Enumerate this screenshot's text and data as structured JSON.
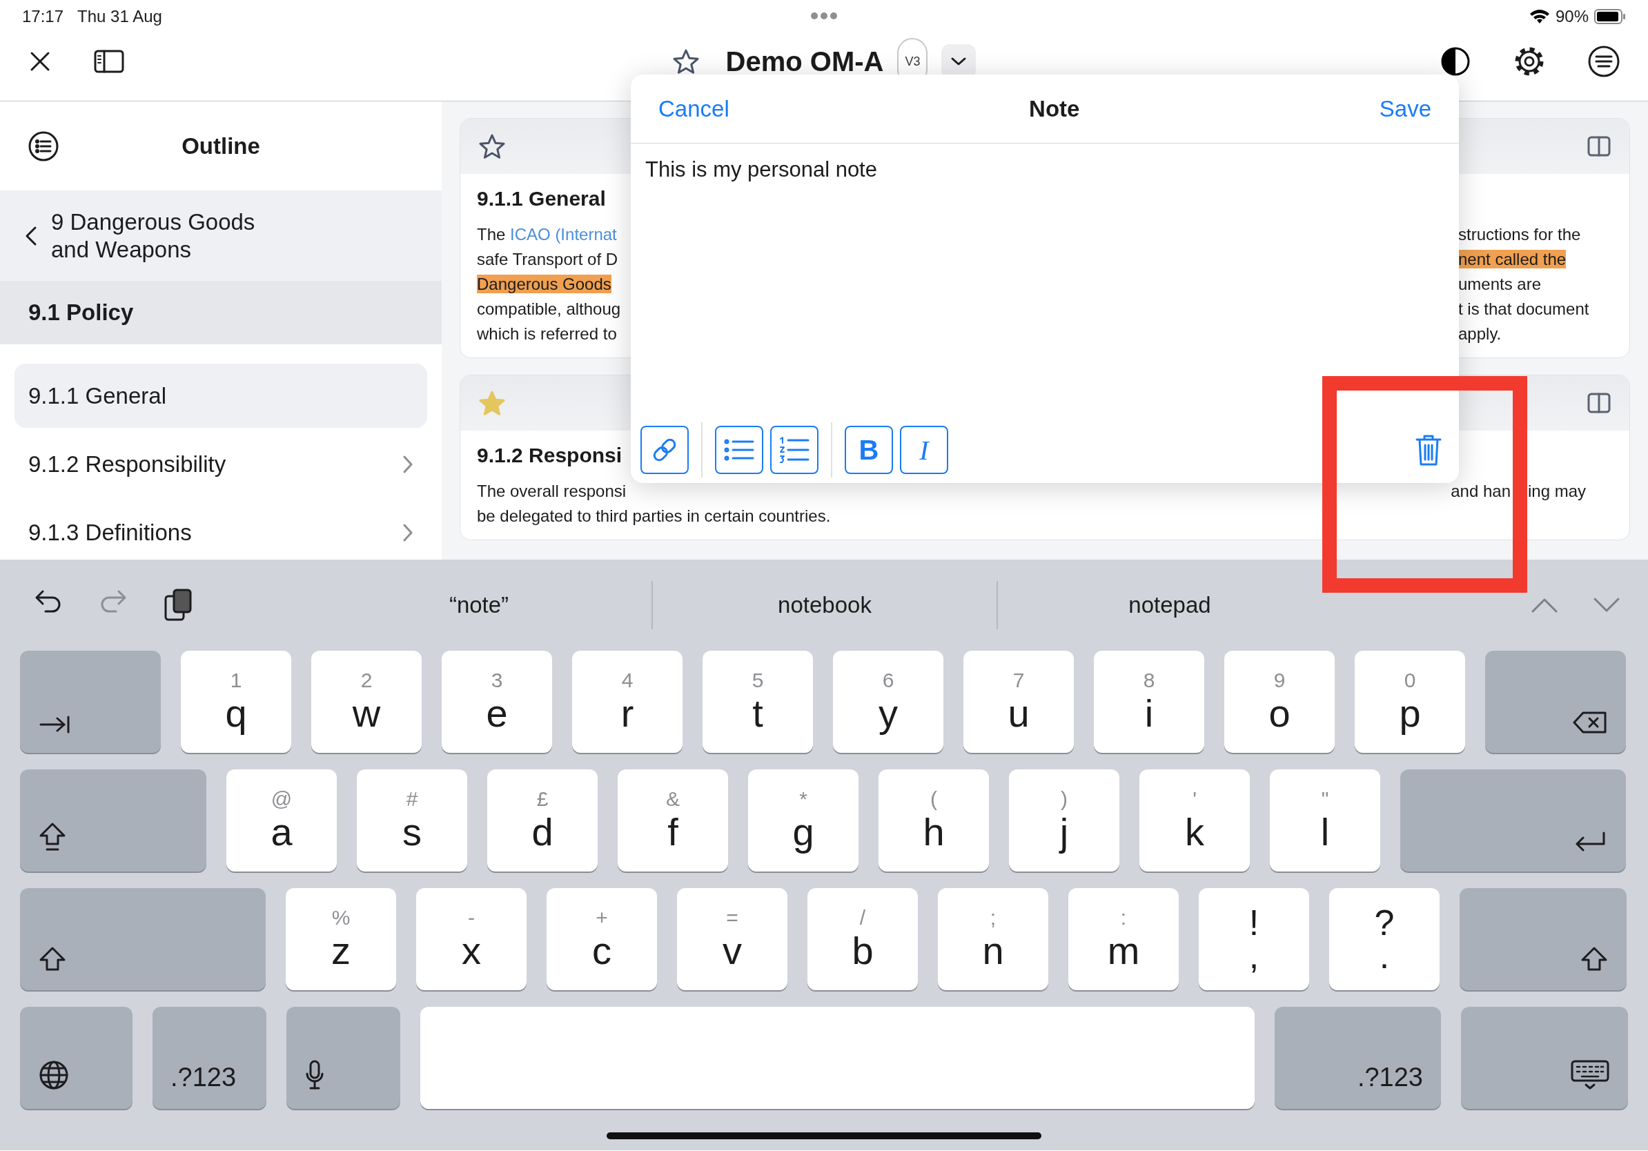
{
  "status_bar": {
    "time": "17:17",
    "date": "Thu 31 Aug",
    "battery": "90%"
  },
  "header": {
    "title": "Demo OM-A",
    "version": "V3"
  },
  "sidebar": {
    "title": "Outline",
    "parent": "9 Dangerous Goods and Weapons",
    "section": "9.1 Policy",
    "items": [
      {
        "label": "9.1.1 General",
        "selected": true,
        "expandable": false
      },
      {
        "label": "9.1.2 Responsibility",
        "selected": false,
        "expandable": true
      },
      {
        "label": "9.1.3 Definitions",
        "selected": false,
        "expandable": true
      }
    ]
  },
  "cards": [
    {
      "starred": false,
      "title": "9.1.1 General",
      "rows": [
        {
          "left": [
            {
              "kind": "plain",
              "text": "The "
            },
            {
              "kind": "link",
              "text": "ICAO (Internat"
            }
          ],
          "right": [
            [
              {
                "kind": "plain",
                "text": "structions for the"
              }
            ]
          ]
        },
        {
          "left": [
            {
              "kind": "plain",
              "text": "safe Transport of D"
            }
          ],
          "right": [
            [
              {
                "kind": "highlight",
                "text": "nent called the"
              }
            ]
          ]
        },
        {
          "left": [
            {
              "kind": "highlight",
              "text": "Dangerous Goods"
            }
          ],
          "right": [
            [
              {
                "kind": "plain",
                "text": "uments are"
              }
            ]
          ]
        },
        {
          "left": [
            {
              "kind": "plain",
              "text": "compatible, althoug"
            }
          ],
          "right": [
            [
              {
                "kind": "plain",
                "text": "t is that document"
              }
            ]
          ]
        },
        {
          "left": [
            {
              "kind": "plain",
              "text": "which is referred to"
            }
          ],
          "right": [
            [
              {
                "kind": "plain",
                "text": "apply."
              }
            ]
          ]
        }
      ]
    },
    {
      "starred": true,
      "title": "9.1.2 Responsi",
      "rows": [
        {
          "left": [
            {
              "kind": "plain",
              "text": "The overall responsi"
            }
          ],
          "right": [
            [
              {
                "kind": "plain",
                "text": "and han"
              }
            ],
            [
              {
                "kind": "plain",
                "text": "ing may"
              }
            ]
          ]
        },
        {
          "left": [
            {
              "kind": "plain",
              "text": "be delegated to third parties in certain countries."
            }
          ]
        }
      ]
    }
  ],
  "note": {
    "cancel": "Cancel",
    "title": "Note",
    "save": "Save",
    "text": "This is my personal note",
    "tools": [
      {
        "kind": "link"
      },
      {
        "kind": "bullets"
      },
      {
        "kind": "numbers"
      },
      {
        "kind": "bold",
        "label": "B"
      },
      {
        "kind": "italic",
        "label": "I"
      }
    ]
  },
  "keyboard": {
    "undo_enabled": true,
    "redo_enabled": false,
    "suggestions": [
      "“note”",
      "notebook",
      "notepad"
    ],
    "rows": [
      {
        "keys": [
          {
            "kind": "tab"
          },
          {
            "kind": "letter",
            "hint": "1",
            "label": "q"
          },
          {
            "kind": "letter",
            "hint": "2",
            "label": "w"
          },
          {
            "kind": "letter",
            "hint": "3",
            "label": "e"
          },
          {
            "kind": "letter",
            "hint": "4",
            "label": "r"
          },
          {
            "kind": "letter",
            "hint": "5",
            "label": "t"
          },
          {
            "kind": "letter",
            "hint": "6",
            "label": "y"
          },
          {
            "kind": "letter",
            "hint": "7",
            "label": "u"
          },
          {
            "kind": "letter",
            "hint": "8",
            "label": "i"
          },
          {
            "kind": "letter",
            "hint": "9",
            "label": "o"
          },
          {
            "kind": "letter",
            "hint": "0",
            "label": "p"
          },
          {
            "kind": "delete"
          }
        ]
      },
      {
        "keys": [
          {
            "kind": "caps"
          },
          {
            "kind": "letter",
            "hint": "@",
            "label": "a"
          },
          {
            "kind": "letter",
            "hint": "#",
            "label": "s"
          },
          {
            "kind": "letter",
            "hint": "£",
            "label": "d"
          },
          {
            "kind": "letter",
            "hint": "&",
            "label": "f"
          },
          {
            "kind": "letter",
            "hint": "*",
            "label": "g"
          },
          {
            "kind": "letter",
            "hint": "(",
            "label": "h"
          },
          {
            "kind": "letter",
            "hint": ")",
            "label": "j"
          },
          {
            "kind": "letter",
            "hint": "'",
            "label": "k"
          },
          {
            "kind": "letter",
            "hint": "\"",
            "label": "l"
          },
          {
            "kind": "return"
          }
        ]
      },
      {
        "keys": [
          {
            "kind": "shift"
          },
          {
            "kind": "letter",
            "hint": "%",
            "label": "z"
          },
          {
            "kind": "letter",
            "hint": "-",
            "label": "x"
          },
          {
            "kind": "letter",
            "hint": "+",
            "label": "c"
          },
          {
            "kind": "letter",
            "hint": "=",
            "label": "v"
          },
          {
            "kind": "letter",
            "hint": "/",
            "label": "b"
          },
          {
            "kind": "letter",
            "hint": ";",
            "label": "n"
          },
          {
            "kind": "letter",
            "hint": ":",
            "label": "m"
          },
          {
            "kind": "punct",
            "top": "!",
            "bottom": ","
          },
          {
            "kind": "punct",
            "top": "?",
            "bottom": "."
          },
          {
            "kind": "shift"
          }
        ]
      },
      {
        "keys": [
          {
            "kind": "globe"
          },
          {
            "kind": "symbols",
            "label": ".?123"
          },
          {
            "kind": "mic"
          },
          {
            "kind": "space"
          },
          {
            "kind": "symbols",
            "label": ".?123"
          },
          {
            "kind": "dismiss"
          }
        ]
      }
    ]
  }
}
